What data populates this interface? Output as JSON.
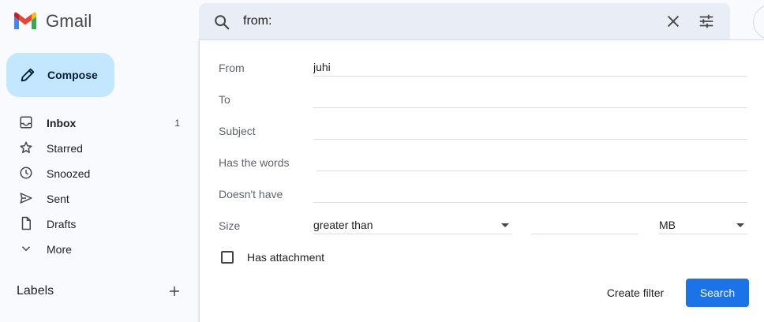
{
  "app": {
    "name": "Gmail"
  },
  "search": {
    "query": "from:"
  },
  "compose": {
    "label": "Compose"
  },
  "sidebar": {
    "items": [
      {
        "label": "Inbox",
        "count": "1",
        "icon": "inbox-icon"
      },
      {
        "label": "Starred",
        "count": "",
        "icon": "star-icon"
      },
      {
        "label": "Snoozed",
        "count": "",
        "icon": "clock-icon"
      },
      {
        "label": "Sent",
        "count": "",
        "icon": "send-icon"
      },
      {
        "label": "Drafts",
        "count": "",
        "icon": "draft-icon"
      },
      {
        "label": "More",
        "count": "",
        "icon": "chevron-down-icon"
      }
    ],
    "labels_title": "Labels"
  },
  "advanced_search": {
    "from_label": "From",
    "from_value": "juhi",
    "to_label": "To",
    "to_value": "",
    "subject_label": "Subject",
    "subject_value": "",
    "has_words_label": "Has the words",
    "has_words_value": "",
    "doesnt_have_label": "Doesn't have",
    "doesnt_have_value": "",
    "size_label": "Size",
    "size_operator": "greater than",
    "size_value": "",
    "size_unit": "MB",
    "attachment_label": "Has attachment",
    "create_filter_label": "Create filter",
    "search_label": "Search"
  },
  "colors": {
    "compose_bg": "#c2e7ff",
    "search_bar_bg": "#e9eef6",
    "primary_button": "#1a73e8",
    "page_bg": "#f8fafd"
  }
}
